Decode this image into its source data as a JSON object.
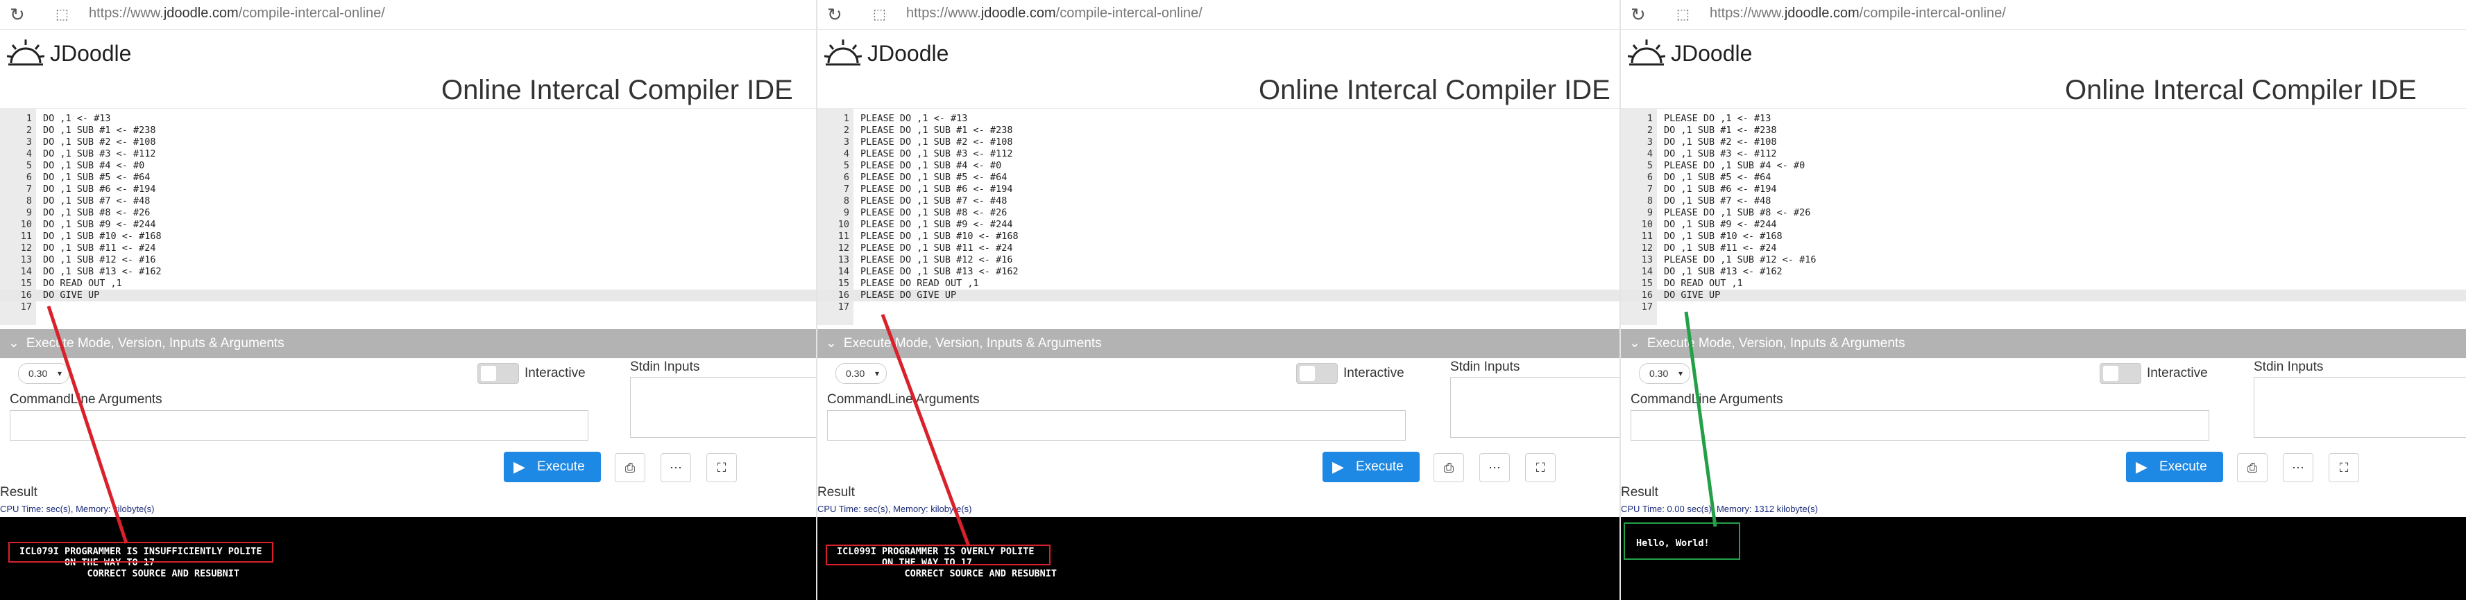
{
  "browser": {
    "url_prefix": "https://www.",
    "url_domain": "jdoodle.com",
    "url_path": "/compile-intercal-online/"
  },
  "app": {
    "brand": "JDoodle",
    "ide_title": "Online Intercal Compiler IDE"
  },
  "settings": {
    "section_label": "Execute Mode, Version, Inputs & Arguments",
    "version": "0.30",
    "interactive_label": "Interactive",
    "stdin_label": "Stdin Inputs",
    "cmd_label": "CommandLine Arguments",
    "execute_label": "Execute"
  },
  "result": {
    "label": "Result"
  },
  "panels": [
    {
      "code": [
        "DO ,1 <- #13",
        "DO ,1 SUB #1 <- #238",
        "DO ,1 SUB #2 <- #108",
        "DO ,1 SUB #3 <- #112",
        "DO ,1 SUB #4 <- #0",
        "DO ,1 SUB #5 <- #64",
        "DO ,1 SUB #6 <- #194",
        "DO ,1 SUB #7 <- #48",
        "DO ,1 SUB #8 <- #26",
        "DO ,1 SUB #9 <- #244",
        "DO ,1 SUB #10 <- #168",
        "DO ,1 SUB #11 <- #24",
        "DO ,1 SUB #12 <- #16",
        "DO ,1 SUB #13 <- #162",
        "DO READ OUT ,1",
        "DO GIVE UP",
        ""
      ],
      "stats": "CPU Time: sec(s), Memory: kilobyte(s)",
      "output": [
        "ICL079I PROGRAMMER IS INSUFFICIENTLY POLITE",
        "        ON THE WAY TO 17",
        "            CORRECT SOURCE AND RESUBNIT"
      ],
      "annotation_color": "#d9212c"
    },
    {
      "code": [
        "PLEASE DO ,1 <- #13",
        "PLEASE DO ,1 SUB #1 <- #238",
        "PLEASE DO ,1 SUB #2 <- #108",
        "PLEASE DO ,1 SUB #3 <- #112",
        "PLEASE DO ,1 SUB #4 <- #0",
        "PLEASE DO ,1 SUB #5 <- #64",
        "PLEASE DO ,1 SUB #6 <- #194",
        "PLEASE DO ,1 SUB #7 <- #48",
        "PLEASE DO ,1 SUB #8 <- #26",
        "PLEASE DO ,1 SUB #9 <- #244",
        "PLEASE DO ,1 SUB #10 <- #168",
        "PLEASE DO ,1 SUB #11 <- #24",
        "PLEASE DO ,1 SUB #12 <- #16",
        "PLEASE DO ,1 SUB #13 <- #162",
        "PLEASE DO READ OUT ,1",
        "PLEASE DO GIVE UP",
        ""
      ],
      "stats": "CPU Time: sec(s), Memory: kilobyte(s)",
      "output": [
        "ICL099I PROGRAMMER IS OVERLY POLITE",
        "        ON THE WAY TO 17",
        "            CORRECT SOURCE AND RESUBNIT"
      ],
      "annotation_color": "#d9212c"
    },
    {
      "code": [
        "PLEASE DO ,1 <- #13",
        "DO ,1 SUB #1 <- #238",
        "DO ,1 SUB #2 <- #108",
        "DO ,1 SUB #3 <- #112",
        "PLEASE DO ,1 SUB #4 <- #0",
        "DO ,1 SUB #5 <- #64",
        "DO ,1 SUB #6 <- #194",
        "DO ,1 SUB #7 <- #48",
        "PLEASE DO ,1 SUB #8 <- #26",
        "DO ,1 SUB #9 <- #244",
        "DO ,1 SUB #10 <- #168",
        "DO ,1 SUB #11 <- #24",
        "PLEASE DO ,1 SUB #12 <- #16",
        "DO ,1 SUB #13 <- #162",
        "DO READ OUT ,1",
        "DO GIVE UP",
        ""
      ],
      "stats": "CPU Time: 0.00 sec(s), Memory: 1312 kilobyte(s)",
      "output": [
        "Hello, World!"
      ],
      "annotation_color": "#23a047"
    }
  ],
  "icons": {
    "reload": "reload-icon",
    "lock": "lock-icon",
    "logo": "sun-logo-icon",
    "chevron": "chevron-down-icon",
    "play": "play-icon",
    "file": "file-icon",
    "more": "more-icon",
    "fullscreen": "fullscreen-icon"
  },
  "colors": {
    "execute_button": "#1e88e5",
    "terminal_bg": "#000000",
    "mode_bar": "#b3b3b3"
  }
}
